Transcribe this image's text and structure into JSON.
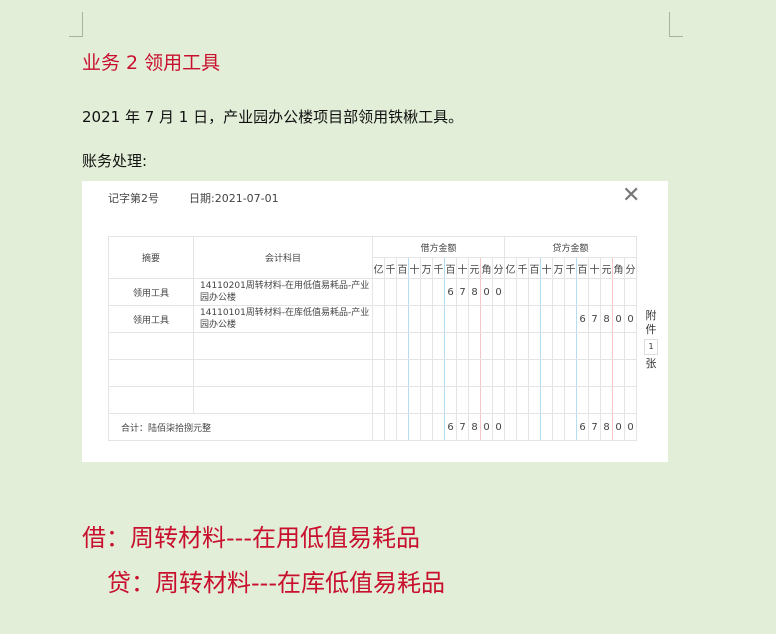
{
  "heading": "业务 2 领用工具",
  "description": "2021 年 7 月 1 日，产业园办公楼项目部领用铁楸工具。",
  "accounting_label": "账务处理:",
  "voucher": {
    "number": "记字第2号",
    "date": "日期:2021-07-01",
    "headers": {
      "summary": "摘要",
      "account": "会计科目",
      "debit": "借方金额",
      "credit": "贷方金额"
    },
    "units": [
      "亿",
      "千",
      "百",
      "十",
      "万",
      "千",
      "百",
      "十",
      "元",
      "角",
      "分"
    ],
    "rows": [
      {
        "summary": "领用工具",
        "account": "14110201周转材料-在用低值易耗品-产业园办公楼",
        "debit": [
          "",
          "",
          "",
          "",
          "",
          "",
          "6",
          "7",
          "8",
          "0",
          "0"
        ],
        "credit": [
          "",
          "",
          "",
          "",
          "",
          "",
          "",
          "",
          "",
          "",
          ""
        ]
      },
      {
        "summary": "领用工具",
        "account": "14110101周转材料-在库低值易耗品-产业园办公楼",
        "debit": [
          "",
          "",
          "",
          "",
          "",
          "",
          "",
          "",
          "",
          "",
          ""
        ],
        "credit": [
          "",
          "",
          "",
          "",
          "",
          "",
          "6",
          "7",
          "8",
          "0",
          "0"
        ]
      },
      {
        "summary": "",
        "account": "",
        "debit": [
          "",
          "",
          "",
          "",
          "",
          "",
          "",
          "",
          "",
          "",
          ""
        ],
        "credit": [
          "",
          "",
          "",
          "",
          "",
          "",
          "",
          "",
          "",
          "",
          ""
        ]
      },
      {
        "summary": "",
        "account": "",
        "debit": [
          "",
          "",
          "",
          "",
          "",
          "",
          "",
          "",
          "",
          "",
          ""
        ],
        "credit": [
          "",
          "",
          "",
          "",
          "",
          "",
          "",
          "",
          "",
          "",
          ""
        ]
      },
      {
        "summary": "",
        "account": "",
        "debit": [
          "",
          "",
          "",
          "",
          "",
          "",
          "",
          "",
          "",
          "",
          ""
        ],
        "credit": [
          "",
          "",
          "",
          "",
          "",
          "",
          "",
          "",
          "",
          "",
          ""
        ]
      }
    ],
    "total": {
      "label": "合计：陆佰柒拾捌元整",
      "debit": [
        "",
        "",
        "",
        "",
        "",
        "",
        "6",
        "7",
        "8",
        "0",
        "0"
      ],
      "credit": [
        "",
        "",
        "",
        "",
        "",
        "",
        "6",
        "7",
        "8",
        "0",
        "0"
      ]
    },
    "attachment": {
      "label_top": "附件",
      "count": "1",
      "label_bottom": "张"
    }
  },
  "entry_debit": "借：周转材料---在用低值易耗品",
  "entry_credit": "贷：周转材料---在库低值易耗品"
}
